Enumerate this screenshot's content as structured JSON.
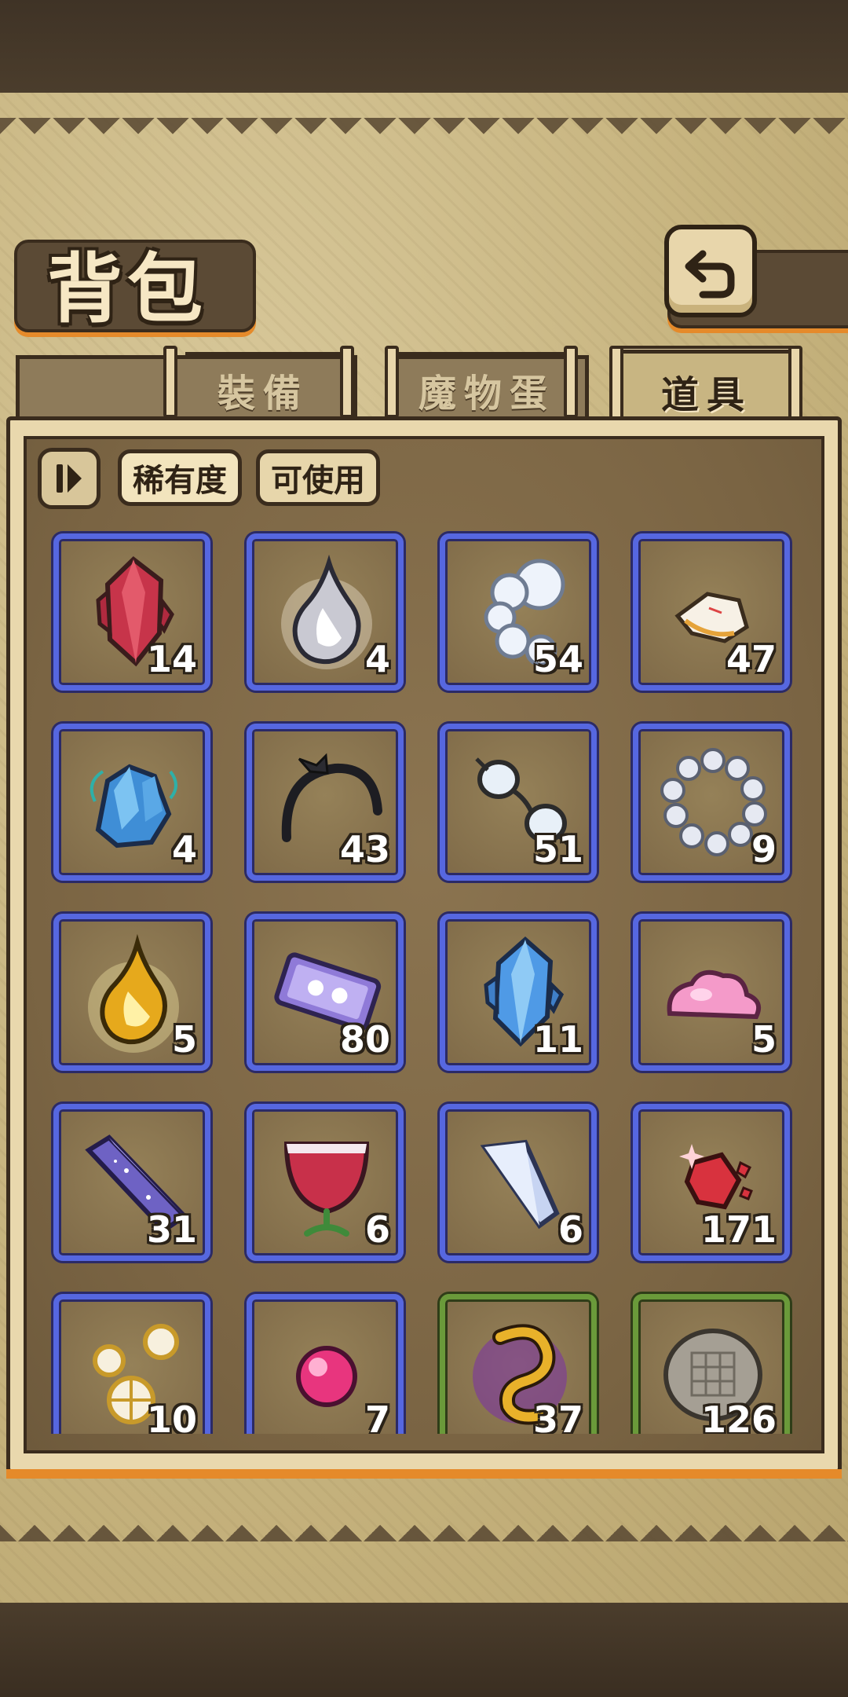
{
  "header": {
    "title": "背包"
  },
  "tabs": [
    {
      "label": "裝備",
      "active": false
    },
    {
      "label": "魔物蛋",
      "active": false
    },
    {
      "label": "道具",
      "active": true
    }
  ],
  "filters": [
    {
      "label": "稀有度",
      "active": true
    },
    {
      "label": "可使用",
      "active": false
    }
  ],
  "items": [
    {
      "icon": "red-crystal-icon",
      "count": "14",
      "rarity": "blue"
    },
    {
      "icon": "white-flame-drop-icon",
      "count": "4",
      "rarity": "blue"
    },
    {
      "icon": "fluffy-cloud-tail-icon",
      "count": "54",
      "rarity": "blue"
    },
    {
      "icon": "paper-scrap-icon",
      "count": "47",
      "rarity": "blue"
    },
    {
      "icon": "blue-crystal-cluster-icon",
      "count": "4",
      "rarity": "blue"
    },
    {
      "icon": "black-headband-icon",
      "count": "43",
      "rarity": "blue"
    },
    {
      "icon": "glasses-icon",
      "count": "51",
      "rarity": "blue"
    },
    {
      "icon": "pearl-bracelet-icon",
      "count": "9",
      "rarity": "blue"
    },
    {
      "icon": "golden-flame-drop-icon",
      "count": "5",
      "rarity": "blue"
    },
    {
      "icon": "purple-ticket-icon",
      "count": "80",
      "rarity": "blue"
    },
    {
      "icon": "blue-crystal-icon",
      "count": "11",
      "rarity": "blue"
    },
    {
      "icon": "pink-slime-icon",
      "count": "5",
      "rarity": "blue"
    },
    {
      "icon": "purple-crystal-bar-icon",
      "count": "31",
      "rarity": "blue"
    },
    {
      "icon": "red-goblet-icon",
      "count": "6",
      "rarity": "blue"
    },
    {
      "icon": "crystal-shard-icon",
      "count": "6",
      "rarity": "blue"
    },
    {
      "icon": "red-gem-fragments-icon",
      "count": "171",
      "rarity": "blue"
    },
    {
      "icon": "golden-gears-icon",
      "count": "10",
      "rarity": "blue"
    },
    {
      "icon": "pink-orb-icon",
      "count": "7",
      "rarity": "blue"
    },
    {
      "icon": "gold-dark-emblem-icon",
      "count": "37",
      "rarity": "green"
    },
    {
      "icon": "stone-tablet-icon",
      "count": "126",
      "rarity": "green"
    }
  ],
  "colors": {
    "rare_blue": "#5667e0",
    "rare_green": "#6a9a3a",
    "accent_orange": "#e58a2a"
  }
}
